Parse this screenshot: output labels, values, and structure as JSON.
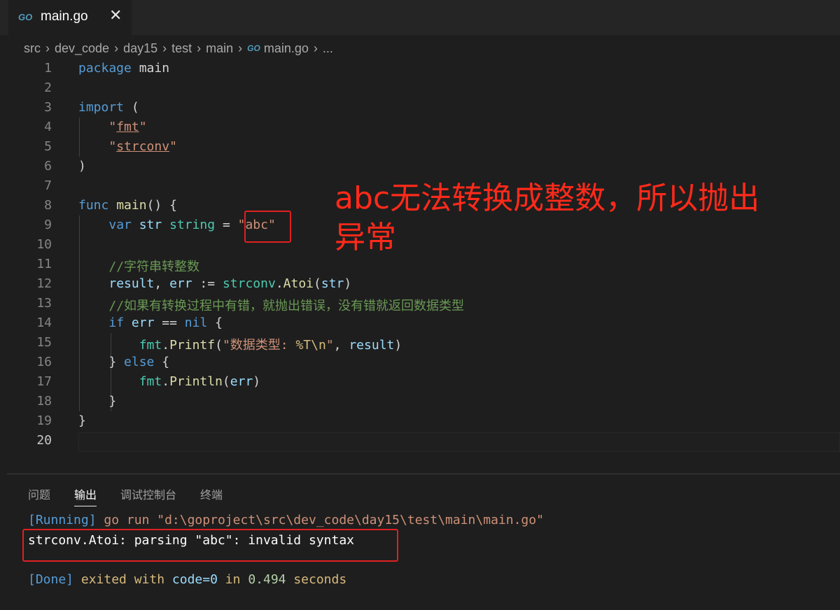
{
  "tab": {
    "icon": "go-file-icon",
    "icon_text": "GO",
    "name": "main.go",
    "close": "✕"
  },
  "breadcrumb": [
    "src",
    "dev_code",
    "day15",
    "test",
    "main",
    "main.go",
    "..."
  ],
  "breadcrumb_icon_text": "GO",
  "editor": {
    "line_numbers": [
      "1",
      "2",
      "3",
      "4",
      "5",
      "6",
      "7",
      "8",
      "9",
      "10",
      "11",
      "12",
      "13",
      "14",
      "15",
      "16",
      "17",
      "18",
      "19",
      "20"
    ],
    "active_line": "20"
  },
  "annotation": {
    "text": "abc无法转换成整数，所以抛出异常",
    "color": "#ff2a1a"
  },
  "panel": {
    "tabs": [
      "问题",
      "输出",
      "调试控制台",
      "终端"
    ],
    "active_tab": "输出",
    "output": {
      "running_tag": "[Running]",
      "running_cmd": " go run \"d:\\goproject\\src\\dev_code\\day15\\test\\main\\main.go\"",
      "error_line": "strconv.Atoi: parsing \"abc\": invalid syntax",
      "done_tag": "[Done]",
      "done_prefix": " exited with ",
      "done_code": "code=0",
      "done_in": " in ",
      "done_time": "0.494",
      "done_suffix": " seconds"
    }
  },
  "colors": {
    "background": "#1e1e1e",
    "keyword": "#569cd6",
    "string": "#ce9178",
    "comment": "#6a9955",
    "highlight_box": "#e02020"
  }
}
